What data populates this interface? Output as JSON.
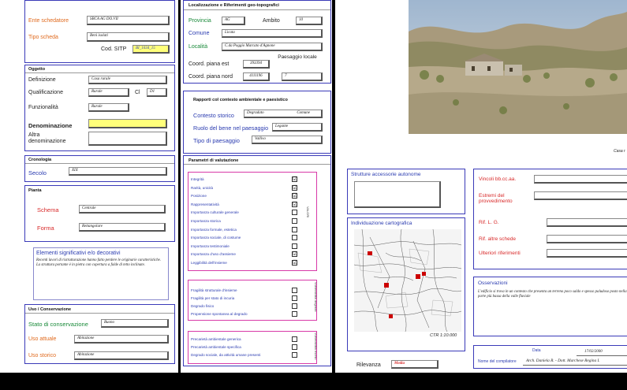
{
  "left": {
    "ente_label": "Ente schedatore",
    "ente_value": "SBCA AG DO.VII",
    "tipo_label": "Tipo scheda",
    "tipo_value": "Beni isolati",
    "cod_label": "Cod. SITP",
    "cod_value": "BI_1034_15",
    "oggetto_header": "Oggetto",
    "definizione_label": "Definizione",
    "definizione_value": "Casa rurale",
    "qualificazione_label": "Qualificazione",
    "qualificazione_value": "Rurale",
    "cl_label": "Cl",
    "cl_value": "D1",
    "funzionalita_label": "Funzionalità",
    "funzionalita_value": "Rurale",
    "denominazione_label": "Denominazione",
    "altra_label": "Altra denominazione",
    "cronologia_header": "Cronologia",
    "secolo_label": "Secolo",
    "secolo_value": "XIX",
    "pianta_header": "Pianta",
    "schema_label": "Schema",
    "schema_value": "Centrale",
    "forma_label": "Forma",
    "forma_value": "Rettangolare",
    "elementi_label": "Elementi significativi e/o decorativi",
    "elementi_text": "Recenti lavori di ristrutturazione hanno fatto perdere le originarie caratteristiche. La struttura portante è in pietra con copertura a falde di tetto inclinate.",
    "uso_header": "Uso / Conservazione",
    "stato_label": "Stato di conservazione",
    "stato_value": "Buono",
    "uso_attuale_label": "Uso attuale",
    "uso_attuale_value": "Abitazione",
    "uso_storico_label": "Uso storico",
    "uso_storico_value": "Abitazione"
  },
  "mid": {
    "loc_header": "Localizzazione e Riferimenti geo-topografici",
    "provincia_label": "Provincia",
    "provincia_value": "AG",
    "ambito_label": "Ambito",
    "ambito_value": "10",
    "comune_label": "Comune",
    "comune_value": "Licata",
    "localita_label": "Località",
    "localita_value": "C.da Poggio Marcato d'Agnone",
    "est_label": "Coord. piana est",
    "est_value": "393394",
    "nord_label": "Coord. piana nord",
    "nord_value": "4111196",
    "paesaggio_label": "Paesaggio locale",
    "paesaggio_value": "7",
    "rapporti_header": "Rapporti col contesto ambientale e paesistico",
    "contesto_label": "Contesto storico",
    "contesto_value": "Degradato",
    "contesto_value2": "Comune",
    "ruolo_label": "Ruolo del bene nel paesaggio",
    "ruolo_value": "Legante",
    "tipo_paes_label": "Tipo di paesaggio",
    "tipo_paes_value": "Vallivo",
    "param_header": "Parametri di valutazione",
    "valori": [
      {
        "label": "Integrità",
        "mark": "☑"
      },
      {
        "label": "Rarità, unicità",
        "mark": "☑"
      },
      {
        "label": "Posizione",
        "mark": "☑"
      },
      {
        "label": "Rappresentatività",
        "mark": "☑"
      },
      {
        "label": "Importanza culturale generale",
        "mark": ""
      },
      {
        "label": "Importanza storica",
        "mark": ""
      },
      {
        "label": "Importanza formale, estetica",
        "mark": ""
      },
      {
        "label": "Importanza sociale, di costume",
        "mark": ""
      },
      {
        "label": "Importanza testimoniale",
        "mark": ""
      },
      {
        "label": "Importanza d'uso d'assieme",
        "mark": "☑"
      },
      {
        "label": "Leggibilità dell'insieme",
        "mark": "☑"
      }
    ],
    "valori_side": "VALORI",
    "degrado": [
      {
        "label": "Fragilità strutturale d'insieme",
        "mark": ""
      },
      {
        "label": "Fragilità per stato di incuria",
        "mark": ""
      },
      {
        "label": "Degrado fisico",
        "mark": ""
      },
      {
        "label": "Propensione spontanea al degrado",
        "mark": ""
      }
    ],
    "degrado_side": "Vulnerabilità degrado",
    "rischio": [
      {
        "label": "Precarietà ambientale generica",
        "mark": ""
      },
      {
        "label": "Precarietà ambientale specifica",
        "mark": ""
      },
      {
        "label": "Degrado sociale, da attività umane presenti",
        "mark": ""
      }
    ],
    "rischio_side": "Vulnerabilità rischio"
  },
  "right": {
    "photo_caption": "Casa r",
    "strutture_label": "Strutture accessorie autonome",
    "carto_label": "Individuazione cartografica",
    "ctr_label": "CTR 1:10.000",
    "rilevanza_label": "Rilevanza",
    "rilevanza_value": "Media",
    "vincoli_label": "Vincoli bb.cc.aa.",
    "estremi_label": "Estremi del provvedimento",
    "prg_label": "Rif. L. G.",
    "altre_label": "Rif. altre schede",
    "ulteriori_label": "Ulteriori riferimenti",
    "osservazioni_label": "Osservazioni",
    "osservazioni_text": "L'edificio si trova in un contesto che presenta un terreno poco saldo e spesso paludoso posto nella parte più bassa della valle fluviale",
    "data_label": "Data",
    "data_value": "17/02/2000",
    "compilatore_label": "Nome del compilatore",
    "compilatore_value": "Arch. Daniela R. - Dott. Marchese Regina I."
  }
}
